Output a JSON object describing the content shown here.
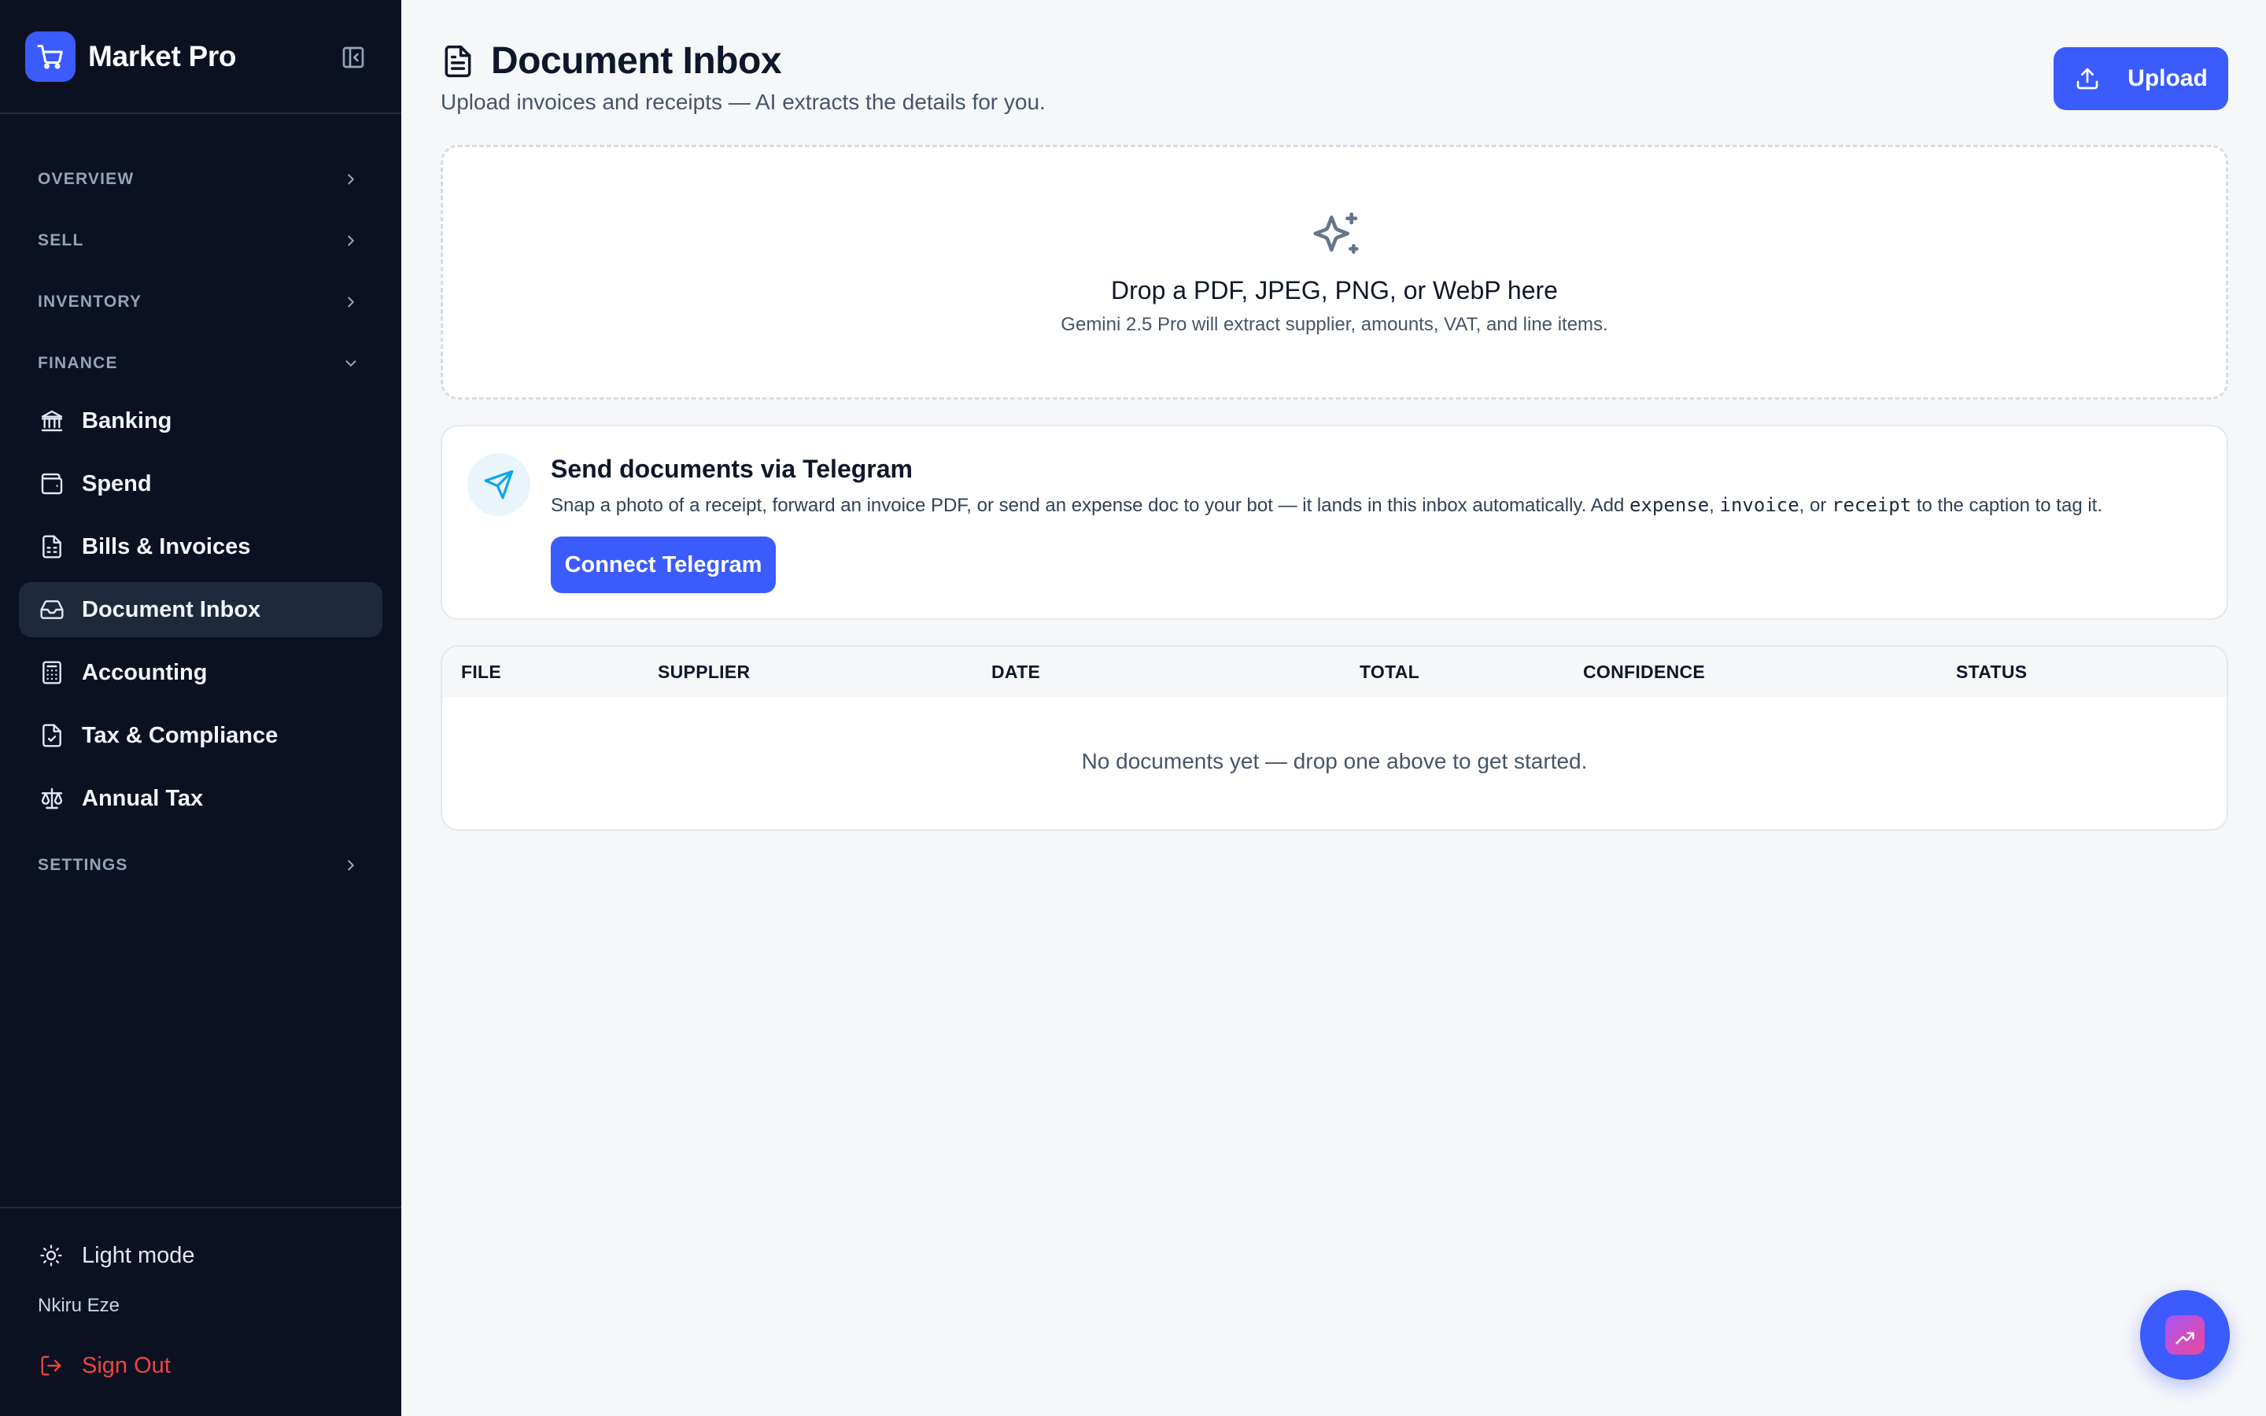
{
  "app": {
    "name": "Market Pro",
    "brand_color": "#3b5bfd"
  },
  "sidebar": {
    "sections": {
      "overview": "OVERVIEW",
      "sell": "SELL",
      "inventory": "INVENTORY",
      "finance": "FINANCE",
      "settings": "SETTINGS"
    },
    "finance_items": [
      {
        "label": "Banking",
        "icon": "bank-icon"
      },
      {
        "label": "Spend",
        "icon": "wallet-icon"
      },
      {
        "label": "Bills & Invoices",
        "icon": "receipt-icon"
      },
      {
        "label": "Document Inbox",
        "icon": "inbox-icon",
        "active": true
      },
      {
        "label": "Accounting",
        "icon": "calculator-icon"
      },
      {
        "label": "Tax & Compliance",
        "icon": "file-check-icon"
      },
      {
        "label": "Annual Tax",
        "icon": "scale-icon"
      }
    ],
    "footer": {
      "theme_toggle": "Light mode",
      "user_name": "Nkiru Eze",
      "sign_out": "Sign Out"
    }
  },
  "page": {
    "title": "Document Inbox",
    "subtitle": "Upload invoices and receipts — AI extracts the details for you.",
    "upload_label": "Upload"
  },
  "dropzone": {
    "title": "Drop a PDF, JPEG, PNG, or WebP here",
    "subtitle": "Gemini 2.5 Pro will extract supplier, amounts, VAT, and line items."
  },
  "telegram": {
    "title": "Send documents via Telegram",
    "desc_prefix": "Snap a photo of a receipt, forward an invoice PDF, or send an expense doc to your bot — it lands in this inbox automatically. Add ",
    "tag_expense": "expense",
    "sep1": ", ",
    "tag_invoice": "invoice",
    "sep2": ", or ",
    "tag_receipt": "receipt",
    "desc_suffix": " to the caption to tag it.",
    "button_label": "Connect Telegram"
  },
  "table": {
    "columns": [
      "FILE",
      "SUPPLIER",
      "DATE",
      "TOTAL",
      "CONFIDENCE",
      "STATUS"
    ],
    "empty_message": "No documents yet — drop one above to get started."
  }
}
